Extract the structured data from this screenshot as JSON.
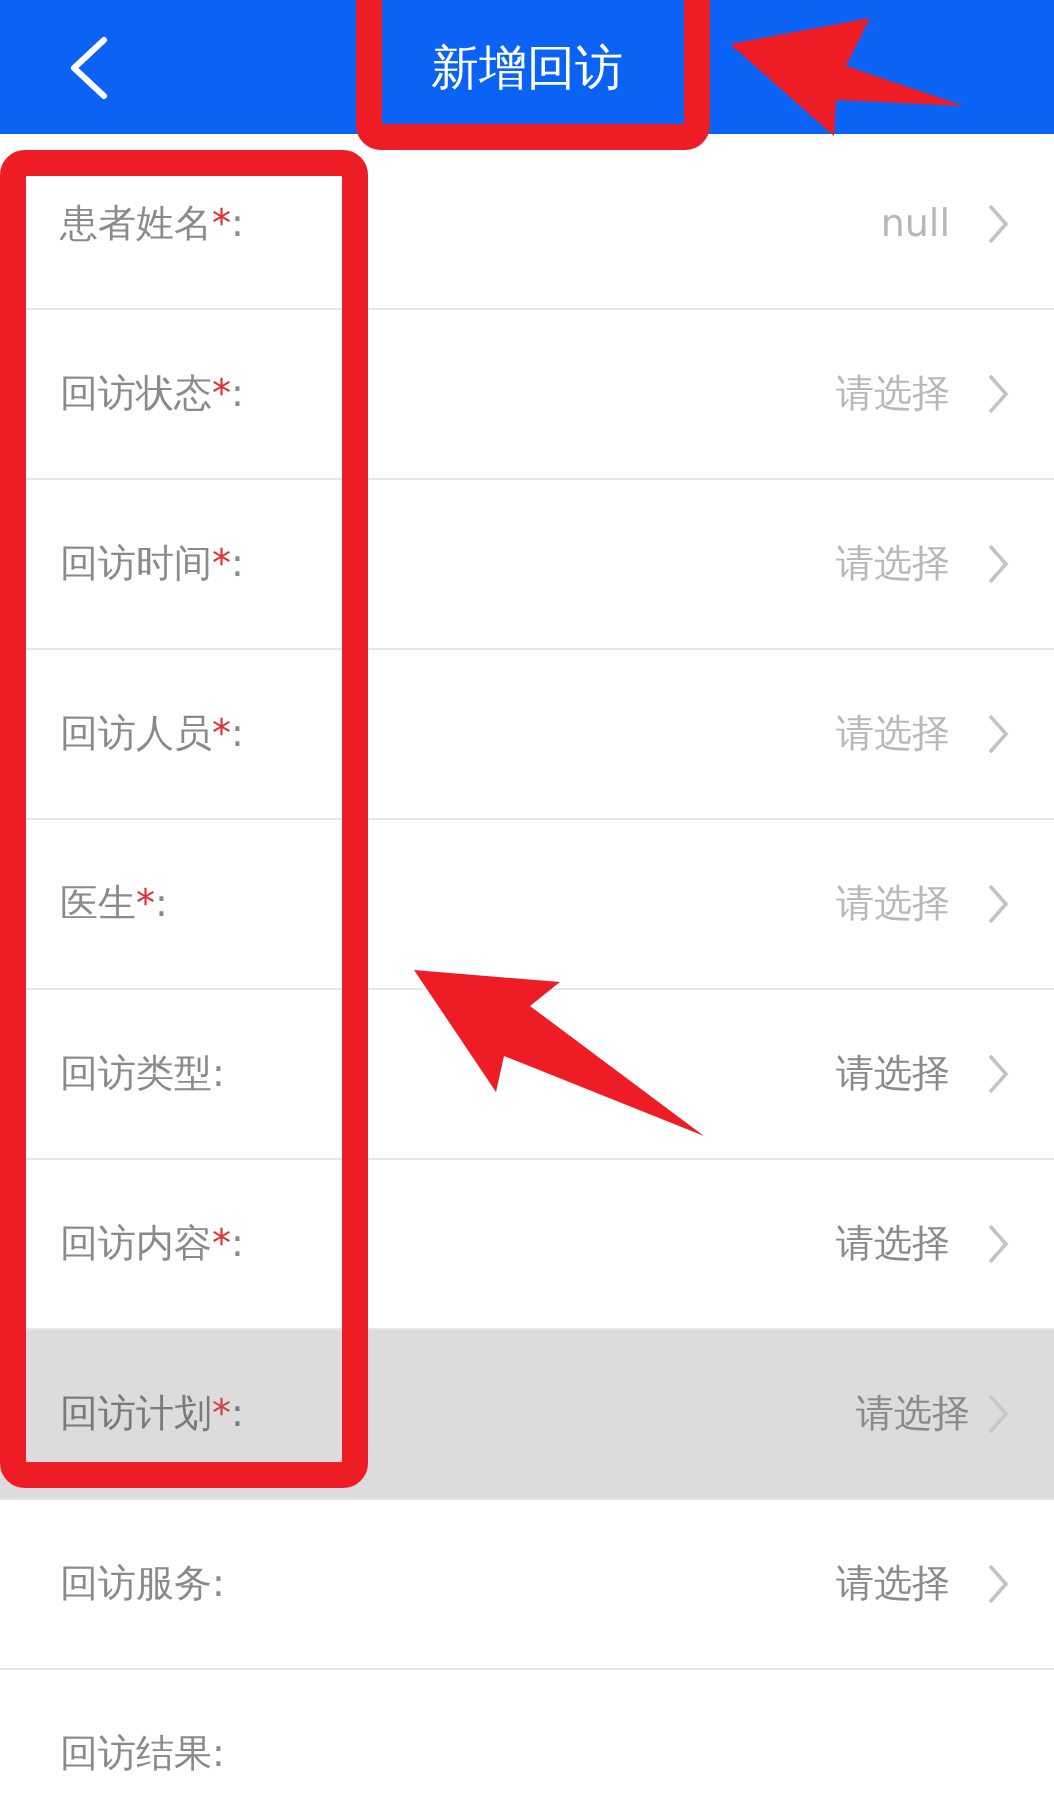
{
  "header": {
    "title": "新增回访"
  },
  "fields": [
    {
      "label": "患者姓名",
      "mark": "*",
      "suffix": ":",
      "value": "null",
      "faded": true,
      "disabled": false
    },
    {
      "label": "回访状态",
      "mark": "*",
      "suffix": ":",
      "value": "请选择",
      "faded": true,
      "disabled": false
    },
    {
      "label": "回访时间",
      "mark": "*",
      "suffix": ":",
      "value": "请选择",
      "faded": true,
      "disabled": false
    },
    {
      "label": "回访人员",
      "mark": "*",
      "suffix": ":",
      "value": "请选择",
      "faded": true,
      "disabled": false
    },
    {
      "label": "医生",
      "mark": "*",
      "suffix": ":",
      "value": "请选择",
      "faded": true,
      "disabled": false
    },
    {
      "label": "回访类型",
      "suffix": ":",
      "value": "请选择",
      "faded": false,
      "disabled": false
    },
    {
      "label": "回访内容",
      "mark": "*",
      "suffix": ":",
      "value": "请选择",
      "faded": false,
      "disabled": false
    },
    {
      "label": "回访计划",
      "mark": "*",
      "suffix": ":",
      "value": "请选择",
      "faded": false,
      "disabled": true
    },
    {
      "label": "回访服务",
      "suffix": ":",
      "value": "请选择",
      "faded": false,
      "disabled": false
    },
    {
      "label": "回访结果",
      "suffix": ":",
      "disabled": false
    }
  ]
}
